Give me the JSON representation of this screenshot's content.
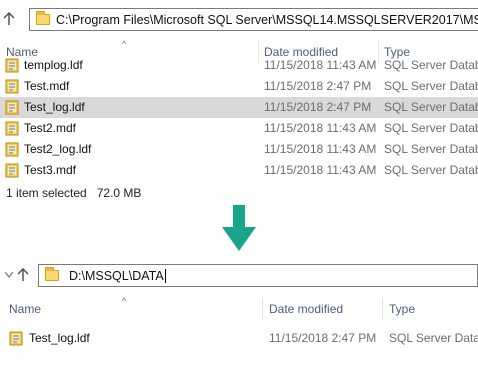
{
  "accent_color": "#1aa489",
  "top_window": {
    "address": "C:\\Program Files\\Microsoft SQL Server\\MSSQL14.MSSQLSERVER2017\\MSSQL\\DATA",
    "columns": {
      "name": "Name",
      "date": "Date modified",
      "type": "Type"
    },
    "files": [
      {
        "name": "templog.ldf",
        "date": "11/15/2018 11:43 AM",
        "type": "SQL Server Database",
        "selected": false
      },
      {
        "name": "Test.mdf",
        "date": "11/15/2018 2:47 PM",
        "type": "SQL Server Database",
        "selected": false
      },
      {
        "name": "Test_log.ldf",
        "date": "11/15/2018 2:47 PM",
        "type": "SQL Server Database",
        "selected": true
      },
      {
        "name": "Test2.mdf",
        "date": "11/15/2018 11:43 AM",
        "type": "SQL Server Database",
        "selected": false
      },
      {
        "name": "Test2_log.ldf",
        "date": "11/15/2018 11:43 AM",
        "type": "SQL Server Database",
        "selected": false
      },
      {
        "name": "Test3.mdf",
        "date": "11/15/2018 11:43 AM",
        "type": "SQL Server Database",
        "selected": false
      }
    ],
    "status": {
      "selected_count": "1 item selected",
      "size": "72.0 MB"
    }
  },
  "arrow_icon": "arrow-down-icon",
  "bottom_window": {
    "address": "D:\\MSSQL\\DATA",
    "columns": {
      "name": "Name",
      "date": "Date modified",
      "type": "Type"
    },
    "files": [
      {
        "name": "Test_log.ldf",
        "date": "11/15/2018 2:47 PM",
        "type": "SQL Server Database"
      }
    ]
  }
}
